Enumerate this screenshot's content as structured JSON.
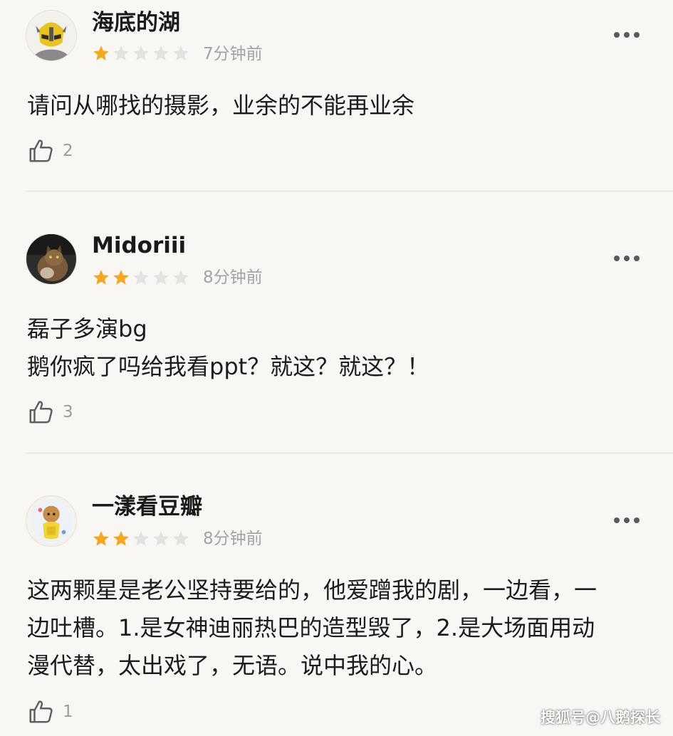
{
  "comments": [
    {
      "username": "海底的湖",
      "rating": 1,
      "max_rating": 5,
      "time": "7分钟前",
      "lines": [
        "请问从哪找的摄影，业余的不能再业余"
      ],
      "likes": "2"
    },
    {
      "username": "Midoriii",
      "rating": 2,
      "max_rating": 5,
      "time": "8分钟前",
      "lines": [
        "磊子多演bg",
        "鹅你疯了吗给我看ppt？就这？就这？！"
      ],
      "likes": "3"
    },
    {
      "username": "一漾看豆瓣",
      "rating": 2,
      "max_rating": 5,
      "time": "8分钟前",
      "lines": [
        "这两颗星是老公坚持要给的，他爱蹭我的剧，一边看，一",
        "边吐槽。1.是女神迪丽热巴的造型毁了，2.是大场面用动",
        "漫代替，太出戏了，无语。说中我的心。"
      ],
      "likes": "1"
    }
  ],
  "watermark": "搜狐号@八鹅探长",
  "colors": {
    "background": "#f8f7f4",
    "star_filled": "#f5a623",
    "star_empty": "#e2e2e2",
    "divider": "#e2e0db"
  },
  "icons": {
    "avatar_1": "robot-helmet-avatar",
    "avatar_2": "cat-avatar",
    "avatar_3": "cartoon-character-avatar",
    "star": "star-icon",
    "more": "more-dots-icon",
    "like": "thumbs-up-icon"
  }
}
